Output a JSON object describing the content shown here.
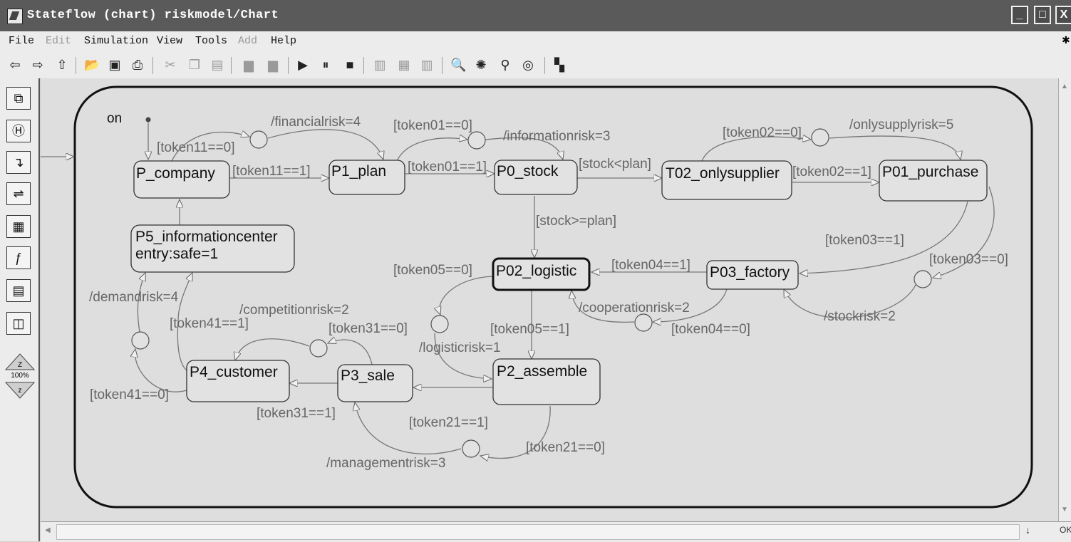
{
  "window": {
    "title": "Stateflow (chart) riskmodel/Chart"
  },
  "menu": {
    "items": [
      {
        "label": "File",
        "disabled": false
      },
      {
        "label": "Edit",
        "disabled": true
      },
      {
        "label": "Simulation",
        "disabled": false
      },
      {
        "label": "View",
        "disabled": false
      },
      {
        "label": "Tools",
        "disabled": false
      },
      {
        "label": "Add",
        "disabled": true
      },
      {
        "label": "Help",
        "disabled": false
      }
    ]
  },
  "palette": {
    "zoom": "100%"
  },
  "statusbar": {
    "text": "OK"
  },
  "chart": {
    "superstate": "on",
    "states": {
      "p_company": "P_company",
      "p1_plan": "P1_plan",
      "p0_stock": "P0_stock",
      "t02": "T02_onlysupplier",
      "p01": "P01_purchase",
      "p5_line1": "P5_informationcenter",
      "p5_line2": "entry:safe=1",
      "p02": "P02_logistic",
      "p03": "P03_factory",
      "p4": "P4_customer",
      "p3": "P3_sale",
      "p2": "P2_assemble"
    },
    "labels": {
      "financialrisk": "/financialrisk=4",
      "token11_0": "[token11==0]",
      "token11_1": "[token11==1]",
      "token01_0": "[token01==0]",
      "informationrisk": "/informationrisk=3",
      "token01_1": "[token01==1]",
      "stock_lt_plan": "[stock<plan]",
      "token02_0": "[token02==0]",
      "onlysupplyrisk": "/onlysupplyrisk=5",
      "token02_1": "[token02==1]",
      "stock_ge_plan": "[stock>=plan]",
      "token03_1": "[token03==1]",
      "token03_0": "[token03==0]",
      "token05_0": "[token05==0]",
      "token04_1": "[token04==1]",
      "cooperationrisk": "/cooperationrisk=2",
      "token04_0": "[token04==0]",
      "stockrisk": "/stockrisk=2",
      "demandrisk": "/demandrisk=4",
      "competitionrisk": "/competitionrisk=2",
      "token41_1": "[token41==1]",
      "token31_0": "[token31==0]",
      "token05_1": "[token05==1]",
      "logisticrisk": "/logisticrisk=1",
      "token41_0": "[token41==0]",
      "token31_1": "[token31==1]",
      "token21_1": "[token21==1]",
      "token21_0": "[token21==0]",
      "managementrisk": "/managementrisk=3"
    }
  }
}
